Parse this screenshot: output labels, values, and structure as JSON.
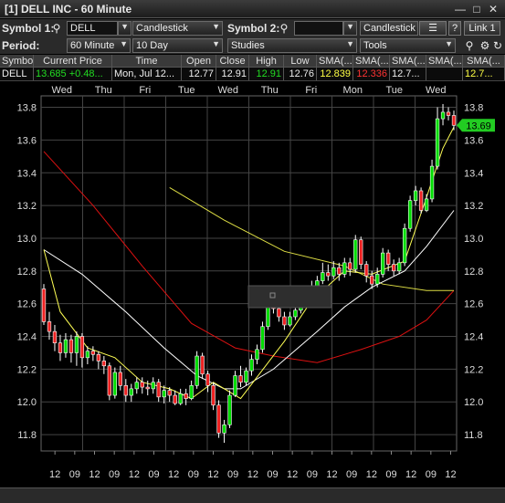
{
  "window": {
    "title": "[1] DELL INC - 60 Minute"
  },
  "toolbar": {
    "symbol1_label": "Symbol 1:",
    "symbol1_value": "DELL",
    "chart_type_1": "Candlestick",
    "symbol2_label": "Symbol 2:",
    "symbol2_value": "",
    "chart_type_2": "Candlestick",
    "help": "?",
    "link": "Link 1",
    "period_label": "Period:",
    "interval": "60 Minute",
    "range": "10 Day",
    "studies": "Studies",
    "tools": "Tools"
  },
  "quote": {
    "headers": [
      "Symbol",
      "Current Price",
      "Time",
      "Open",
      "Close",
      "High",
      "Low",
      "SMA(...",
      "SMA(...",
      "SMA(...",
      "SMA(...",
      "SMA(..."
    ],
    "values": [
      "DELL",
      "13.685",
      "+0.48...",
      "Mon, Jul 12...",
      "12.77",
      "12.91",
      "12.91",
      "12.76",
      "12.839",
      "12.336",
      "12.7...",
      "12.7..."
    ]
  },
  "colors": {
    "up": "#00dd00",
    "down": "#ee2222",
    "sma_short": "#ffff55",
    "sma_mid": "#ffffff",
    "sma_long": "#dd1111",
    "sma_vlong": "#dddd44",
    "last_price_bg": "#22cc22"
  },
  "chart_data": {
    "type": "candlestick",
    "last_price_label": "13.69",
    "y_ticks": [
      "13.8",
      "13.6",
      "13.4",
      "13.2",
      "13.0",
      "12.8",
      "12.6",
      "12.4",
      "12.2",
      "12.0",
      "11.8"
    ],
    "ylim": [
      11.7,
      13.87
    ],
    "day_labels": [
      "Wed",
      "Thu",
      "Fri",
      "Tue",
      "Wed",
      "Thu",
      "Fri",
      "Mon",
      "Tue",
      "Wed"
    ],
    "hour_labels": [
      "12",
      "09",
      "12",
      "09",
      "12",
      "09",
      "12",
      "09",
      "12",
      "09",
      "12",
      "09",
      "12",
      "09",
      "12",
      "09",
      "12",
      "09",
      "12",
      "09",
      "12"
    ],
    "candles": [
      [
        12.69,
        12.49,
        12.72,
        12.47
      ],
      [
        12.49,
        12.43,
        12.55,
        12.38
      ],
      [
        12.43,
        12.36,
        12.47,
        12.31
      ],
      [
        12.36,
        12.3,
        12.41,
        12.25
      ],
      [
        12.3,
        12.38,
        12.42,
        12.27
      ],
      [
        12.38,
        12.3,
        12.41,
        12.24
      ],
      [
        12.3,
        12.4,
        12.43,
        12.22
      ],
      [
        12.4,
        12.27,
        12.42,
        12.21
      ],
      [
        12.27,
        12.31,
        12.34,
        12.23
      ],
      [
        12.31,
        12.29,
        12.34,
        12.25
      ],
      [
        12.29,
        12.25,
        12.31,
        12.2
      ],
      [
        12.25,
        12.22,
        12.28,
        12.17
      ],
      [
        12.22,
        12.04,
        12.24,
        12.01
      ],
      [
        12.04,
        12.18,
        12.21,
        12.02
      ],
      [
        12.18,
        12.1,
        12.22,
        12.07
      ],
      [
        12.1,
        12.04,
        12.14,
        12.0
      ],
      [
        12.04,
        12.08,
        12.11,
        12.0
      ],
      [
        12.08,
        12.12,
        12.15,
        12.05
      ],
      [
        12.12,
        12.09,
        12.15,
        12.05
      ],
      [
        12.09,
        12.08,
        12.13,
        12.04
      ],
      [
        12.08,
        12.12,
        12.15,
        12.05
      ],
      [
        12.12,
        12.03,
        12.14,
        12.0
      ],
      [
        12.03,
        12.07,
        12.1,
        11.99
      ],
      [
        12.07,
        12.04,
        12.09,
        12.0
      ],
      [
        12.04,
        11.99,
        12.07,
        11.98
      ],
      [
        11.99,
        12.05,
        12.08,
        11.98
      ],
      [
        12.05,
        12.02,
        12.08,
        11.98
      ],
      [
        12.02,
        12.1,
        12.13,
        12.01
      ],
      [
        12.1,
        12.28,
        12.31,
        12.08
      ],
      [
        12.28,
        12.17,
        12.3,
        12.14
      ],
      [
        12.17,
        12.1,
        12.19,
        12.06
      ],
      [
        12.1,
        11.98,
        12.12,
        11.95
      ],
      [
        11.98,
        11.81,
        12.01,
        11.78
      ],
      [
        11.81,
        11.86,
        11.89,
        11.75
      ],
      [
        11.86,
        12.04,
        12.07,
        11.84
      ],
      [
        12.04,
        12.16,
        12.19,
        12.03
      ],
      [
        12.16,
        12.12,
        12.22,
        12.09
      ],
      [
        12.12,
        12.19,
        12.21,
        12.1
      ],
      [
        12.19,
        12.26,
        12.29,
        12.16
      ],
      [
        12.26,
        12.32,
        12.35,
        12.23
      ],
      [
        12.32,
        12.46,
        12.49,
        12.3
      ],
      [
        12.46,
        12.62,
        12.65,
        12.44
      ],
      [
        12.62,
        12.57,
        12.65,
        12.54
      ],
      [
        12.57,
        12.52,
        12.6,
        12.49
      ],
      [
        12.52,
        12.47,
        12.55,
        12.44
      ],
      [
        12.47,
        12.52,
        12.55,
        12.46
      ],
      [
        12.52,
        12.56,
        12.59,
        12.5
      ],
      [
        12.56,
        12.63,
        12.66,
        12.54
      ],
      [
        12.63,
        12.68,
        12.71,
        12.61
      ],
      [
        12.68,
        12.71,
        12.74,
        12.66
      ],
      [
        12.71,
        12.74,
        12.77,
        12.69
      ],
      [
        12.74,
        12.79,
        12.85,
        12.72
      ],
      [
        12.79,
        12.77,
        12.84,
        12.74
      ],
      [
        12.77,
        12.82,
        12.86,
        12.75
      ],
      [
        12.82,
        12.78,
        12.85,
        12.74
      ],
      [
        12.78,
        12.85,
        12.88,
        12.76
      ],
      [
        12.85,
        12.81,
        12.88,
        12.77
      ],
      [
        12.81,
        12.99,
        13.02,
        12.79
      ],
      [
        12.99,
        12.84,
        13.01,
        12.81
      ],
      [
        12.84,
        12.77,
        12.86,
        12.73
      ],
      [
        12.77,
        12.72,
        12.8,
        12.69
      ],
      [
        12.72,
        12.78,
        12.82,
        12.7
      ],
      [
        12.78,
        12.91,
        12.94,
        12.76
      ],
      [
        12.91,
        12.84,
        12.93,
        12.8
      ],
      [
        12.84,
        12.8,
        12.87,
        12.77
      ],
      [
        12.8,
        12.85,
        12.88,
        12.78
      ],
      [
        12.85,
        13.06,
        13.09,
        12.83
      ],
      [
        13.06,
        13.23,
        13.26,
        13.04
      ],
      [
        13.23,
        13.29,
        13.32,
        13.2
      ],
      [
        13.29,
        13.17,
        13.31,
        13.15
      ],
      [
        13.17,
        13.24,
        13.27,
        13.16
      ],
      [
        13.24,
        13.44,
        13.48,
        13.22
      ],
      [
        13.44,
        13.73,
        13.8,
        13.42
      ],
      [
        13.73,
        13.77,
        13.82,
        13.69
      ],
      [
        13.77,
        13.75,
        13.8,
        13.72
      ],
      [
        13.75,
        13.69,
        13.78,
        13.66
      ]
    ],
    "sma_short": [
      [
        12.93,
        0
      ],
      [
        12.55,
        3
      ],
      [
        12.33,
        8
      ],
      [
        12.27,
        13
      ],
      [
        12.12,
        18
      ],
      [
        12.08,
        23
      ],
      [
        12.02,
        27
      ],
      [
        12.12,
        31
      ],
      [
        12.02,
        36
      ],
      [
        12.37,
        44
      ],
      [
        12.62,
        49
      ],
      [
        12.8,
        55
      ],
      [
        12.78,
        60
      ],
      [
        12.86,
        66
      ],
      [
        13.25,
        70
      ],
      [
        13.55,
        73
      ],
      [
        13.68,
        75
      ]
    ],
    "sma_mid": [
      [
        12.93,
        0
      ],
      [
        12.78,
        7
      ],
      [
        12.55,
        15
      ],
      [
        12.33,
        22
      ],
      [
        12.16,
        28
      ],
      [
        12.08,
        33
      ],
      [
        12.08,
        36
      ],
      [
        12.2,
        42
      ],
      [
        12.43,
        50
      ],
      [
        12.58,
        55
      ],
      [
        12.7,
        60
      ],
      [
        12.8,
        66
      ],
      [
        12.95,
        70
      ],
      [
        13.17,
        75
      ]
    ],
    "sma_long": [
      [
        13.53,
        0
      ],
      [
        13.2,
        9
      ],
      [
        12.83,
        18
      ],
      [
        12.48,
        27
      ],
      [
        12.33,
        35
      ],
      [
        12.28,
        42
      ],
      [
        12.24,
        50
      ],
      [
        12.32,
        58
      ],
      [
        12.4,
        65
      ],
      [
        12.5,
        70
      ],
      [
        12.68,
        75
      ]
    ],
    "sma_vlong": [
      [
        13.31,
        23
      ],
      [
        13.11,
        33
      ],
      [
        12.92,
        44
      ],
      [
        12.83,
        55
      ],
      [
        12.72,
        62
      ],
      [
        12.68,
        70
      ],
      [
        12.68,
        75
      ]
    ]
  }
}
